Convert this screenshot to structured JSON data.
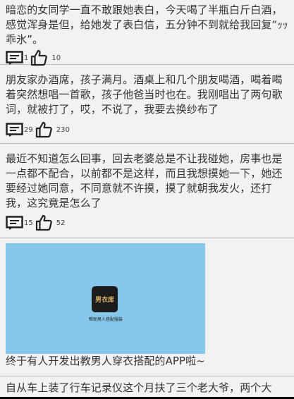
{
  "posts": [
    {
      "text": "暗恋的女同学一直不敢跟她表白，今天喝了半瓶白斤白酒，感觉浑身是但，给她发了表白信，五分钟不到就给我回复“ｯｯ乖氷”。",
      "comments": "1",
      "likes": "10"
    },
    {
      "text": "朋友家办酒席，孩子满月。酒桌上和几个朋友喝酒，喝着喝着突然想唱一首歌，孩子他爸当时也在。我刚唱出了两句歌词，就被打了，哎，不说了，我要去换纱布了",
      "comments": "29",
      "likes": "230"
    },
    {
      "text": "最近不知道怎么回事，回去老婆总是不让我碰她，房事也是一点都不配合，以前都不是这样，而且我想摸她一下，她还要经过她同意，不同意就不许摸，摸了就朝我发火，还打我，这究竟是怎么了",
      "comments": "15",
      "likes": "52"
    }
  ],
  "ad": {
    "logo_text": "男衣库",
    "tagline": "帮助男人搭配服装",
    "caption": "终于有人开发出教男人穿衣搭配的APP啦~"
  },
  "last_post": {
    "text": "自从车上装了行车记录仪这个月扶了三个老大爷，两个大妈，一个孕妇。月收入六万多。只要想讹我的全告了！告一"
  },
  "icons": {
    "comment": "comment-icon",
    "like": "thumbs-up-icon"
  },
  "colors": {
    "background": "#f2f2f2",
    "divider": "#bdbdbd",
    "ad_background": "#87c7eb",
    "logo_bg": "#1c1c1c",
    "logo_text": "#d8b36a"
  }
}
